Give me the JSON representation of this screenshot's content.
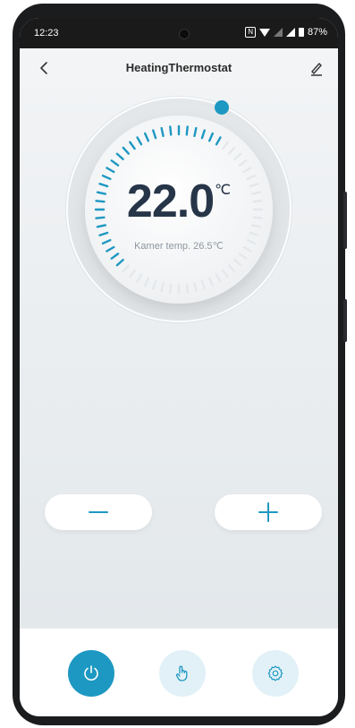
{
  "status_bar": {
    "time": "12:23",
    "nfc": "N",
    "battery": "87%"
  },
  "header": {
    "title": "HeatingThermostat",
    "back_icon": "chevron-left-icon",
    "edit_icon": "pencil-icon"
  },
  "thermostat": {
    "set_temperature": "22.0",
    "unit": "℃",
    "room_temperature_label": "Kamer temp. 26.5℃",
    "accent_color": "#1d98c2"
  },
  "controls": {
    "decrease_icon": "minus-icon",
    "increase_icon": "plus-icon"
  },
  "bottom_bar": {
    "power_icon": "power-icon",
    "manual_icon": "hand-pointer-icon",
    "settings_icon": "gear-icon"
  }
}
